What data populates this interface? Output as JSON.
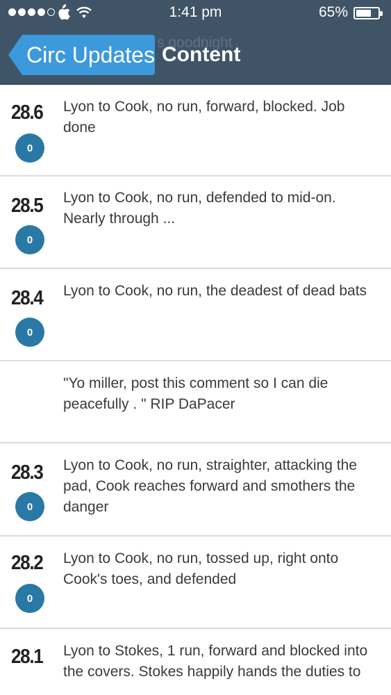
{
  "status_bar": {
    "signal_dots": [
      true,
      true,
      true,
      true,
      false
    ],
    "apple_icon": "apple-icon",
    "wifi_icon": "wifi-icon",
    "time": "1:41 pm",
    "battery_percent": "65%",
    "battery_level": 0.65
  },
  "nav": {
    "back_label": "Circ Updates",
    "title": "Content",
    "ghost_title": "s goodnight"
  },
  "feed": [
    {
      "over": "28.6",
      "runs": "0",
      "text": "Lyon to Cook, no run, forward, blocked. Job done"
    },
    {
      "over": "28.5",
      "runs": "0",
      "text": "Lyon to Cook, no run, defended to mid-on. Nearly through ..."
    },
    {
      "over": "28.4",
      "runs": "0",
      "text": "Lyon to Cook, no run, the deadest of dead bats"
    },
    {
      "over": "",
      "runs": "",
      "text": "\"Yo miller, post this comment so I can die peacefully . \" RIP DaPacer"
    },
    {
      "over": "28.3",
      "runs": "0",
      "text": "Lyon to Cook, no run, straighter, attacking the pad, Cook reaches forward and smothers the danger"
    },
    {
      "over": "28.2",
      "runs": "0",
      "text": "Lyon to Cook, no run, tossed up, right onto Cook's toes, and defended"
    },
    {
      "over": "28.1",
      "runs": "",
      "text": "Lyon to Stokes, 1 run, forward and blocked into the covers. Stokes happily hands the duties to"
    }
  ],
  "colors": {
    "header_bg": "#3f5467",
    "back_button": "#3c99dc",
    "run_badge": "#2a78a6"
  }
}
